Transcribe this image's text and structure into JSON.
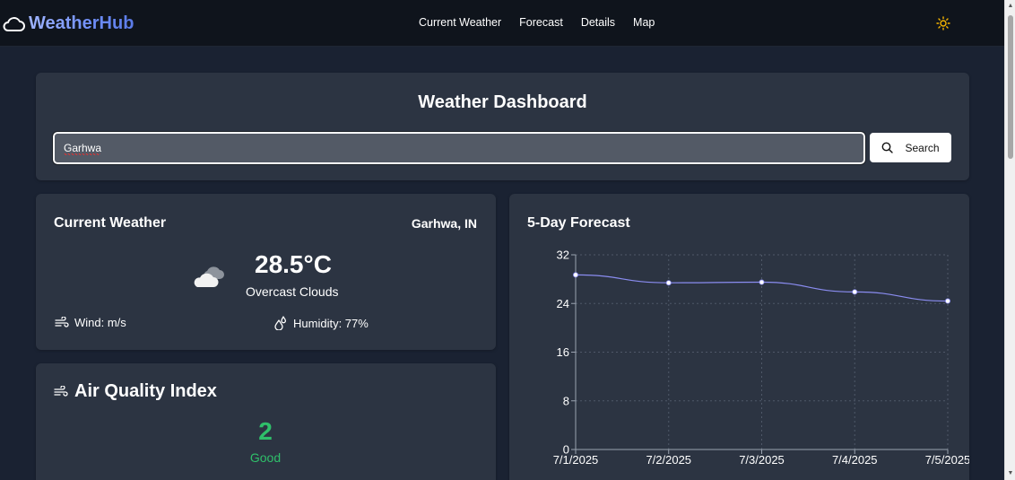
{
  "nav": {
    "brand": "WeatherHub",
    "links": [
      "Current Weather",
      "Forecast",
      "Details",
      "Map"
    ],
    "theme_icon": "sun-icon"
  },
  "dashboard": {
    "title": "Weather Dashboard",
    "search_value": "Garhwa",
    "search_button": "Search"
  },
  "current": {
    "title": "Current Weather",
    "location": "Garhwa, IN",
    "temperature": "28.5°C",
    "description": "Overcast Clouds",
    "wind": "Wind: m/s",
    "humidity": "Humidity: 77%"
  },
  "aqi": {
    "title": "Air Quality Index",
    "value": "2",
    "label": "Good",
    "color": "#2fbf6a"
  },
  "forecast": {
    "title": "5-Day Forecast"
  },
  "chart_data": {
    "type": "line",
    "title": "",
    "xlabel": "",
    "ylabel": "",
    "categories": [
      "7/1/2025",
      "7/2/2025",
      "7/3/2025",
      "7/4/2025",
      "7/5/2025"
    ],
    "series": [
      {
        "values": [
          28.7,
          27.4,
          27.5,
          25.9,
          24.4
        ],
        "color": "#8a8cf0"
      }
    ],
    "ylim": [
      0,
      32
    ],
    "yticks": [
      "0",
      "8",
      "16",
      "24",
      "32"
    ],
    "grid": true
  }
}
